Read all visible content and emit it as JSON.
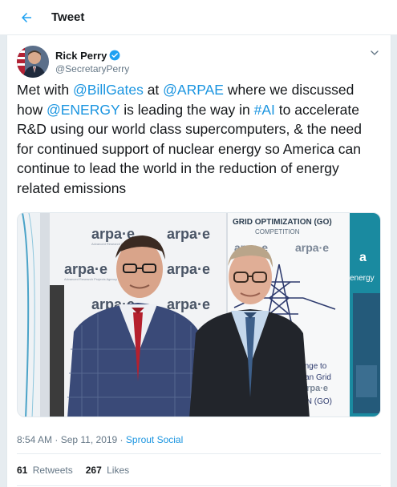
{
  "header": {
    "title": "Tweet"
  },
  "author": {
    "name": "Rick Perry",
    "handle": "@SecretaryPerry"
  },
  "tweet": {
    "segments": [
      {
        "text": "Met with ",
        "mention": false
      },
      {
        "text": "@BillGates",
        "mention": true
      },
      {
        "text": " at ",
        "mention": false
      },
      {
        "text": "@ARPAE",
        "mention": true
      },
      {
        "text": " where we discussed how ",
        "mention": false
      },
      {
        "text": "@ENERGY",
        "mention": true
      },
      {
        "text": " is leading the way in ",
        "mention": false
      },
      {
        "text": "#AI",
        "mention": true
      },
      {
        "text": " to accelerate R&D using our world class supercomputers, & the need for continued support of nuclear energy so America can continue to lead the world in the reduction of energy related emissions",
        "mention": false
      }
    ]
  },
  "photo": {
    "backdrop_logo": "arpa·e",
    "backdrop_subtitle": "Advanced Research Projects Agency · ENERGY",
    "banner_title": "GRID OPTIMIZATION (GO)",
    "banner_subtitle": "COMPETITION",
    "banner_logo": "arpa·e",
    "banner_text_1": "allenge to",
    "banner_text_2": "erican Grid",
    "banner_bottom_logo": "arpa·e",
    "banner_bottom_text": "ON (GO)",
    "right_logo_letter": "a",
    "right_logo_text": "energy"
  },
  "meta": {
    "time": "8:54 AM",
    "separator": " · ",
    "date": "Sep 11, 2019",
    "source": "Sprout Social"
  },
  "stats": {
    "retweets_count": "61",
    "retweets_label": "Retweets",
    "likes_count": "267",
    "likes_label": "Likes"
  },
  "colors": {
    "accent": "#1da1f2",
    "link": "#1b95e0",
    "muted": "#657786",
    "background": "#e6ecf0"
  },
  "icons": {
    "back": "arrow-left-icon",
    "verified": "verified-badge-icon",
    "caret": "chevron-down-icon"
  }
}
